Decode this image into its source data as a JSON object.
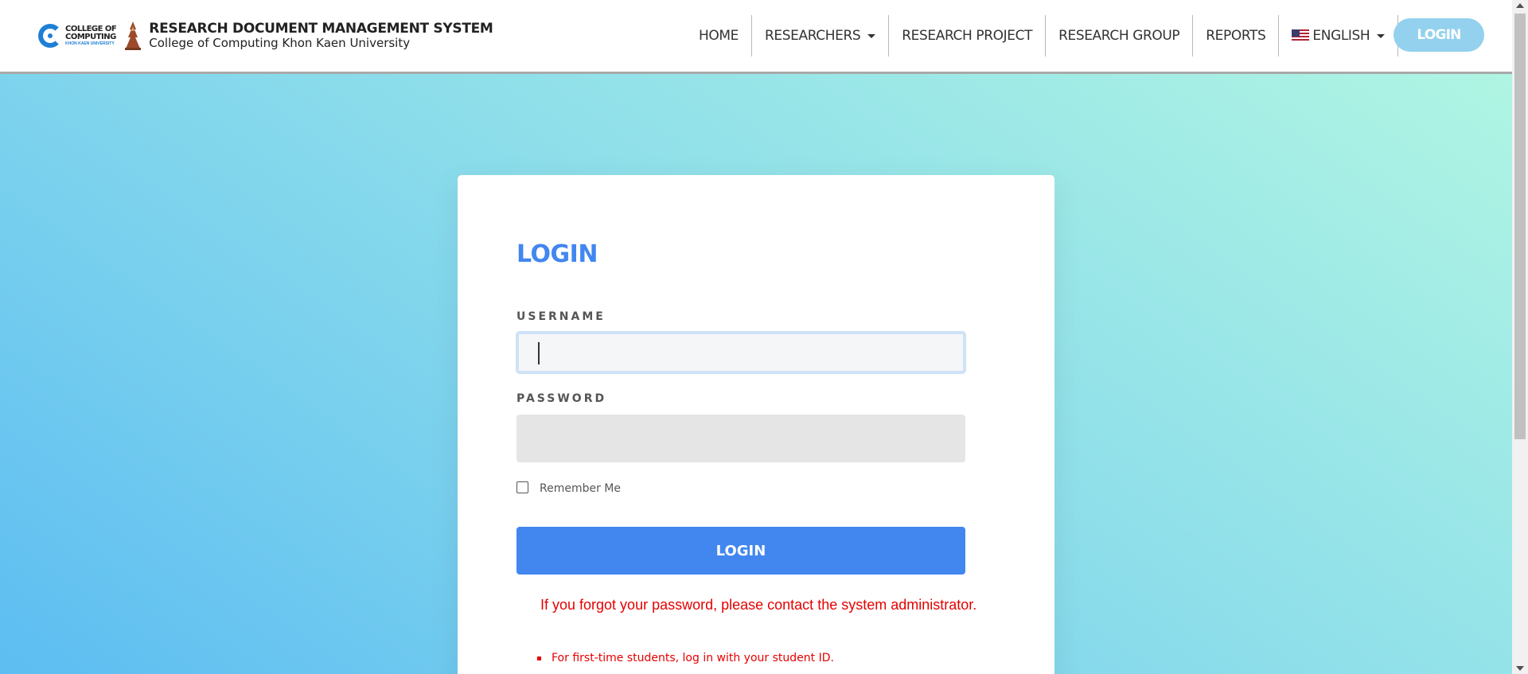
{
  "header": {
    "logo_line1": "COLLEGE OF",
    "logo_line2": "COMPUTING",
    "logo_line3": "KHON KAEN UNIVERSITY",
    "title": "RESEARCH DOCUMENT MANAGEMENT SYSTEM",
    "subtitle": "College of Computing Khon Kaen University"
  },
  "nav": {
    "home": "HOME",
    "researchers": "RESEARCHERS",
    "research_project": "RESEARCH PROJECT",
    "research_group": "RESEARCH GROUP",
    "reports": "REPORTS",
    "language": "ENGLISH",
    "login": "LOGIN"
  },
  "form": {
    "title": "LOGIN",
    "username_label": "USERNAME",
    "username_value": "",
    "password_label": "PASSWORD",
    "password_value": "",
    "remember_label": "Remember Me",
    "remember_checked": false,
    "submit_label": "LOGIN",
    "forgot_text": "If you forgot your password, please contact the system administrator.",
    "notes": [
      "For first-time students, log in with your student ID."
    ]
  },
  "colors": {
    "accent": "#4286f0",
    "nav_login_bg": "#93d1ee",
    "error_text": "#e60000",
    "gradient_start": "#5dbdf2",
    "gradient_end": "#b0f5e3"
  }
}
